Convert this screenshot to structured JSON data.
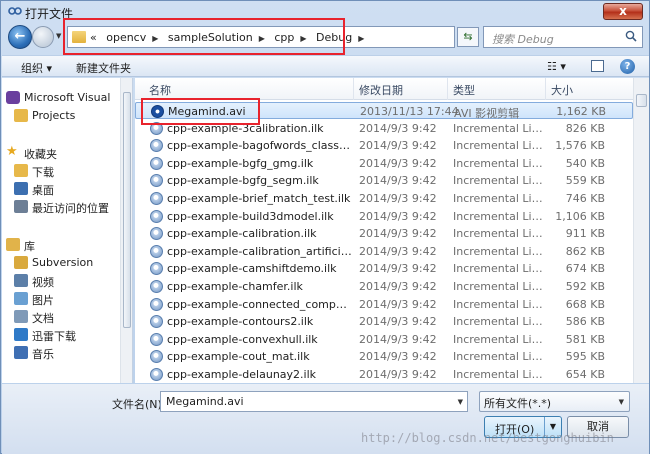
{
  "window": {
    "title": "打开文件",
    "close_label": "x"
  },
  "nav": {
    "back_glyph": "←"
  },
  "address": {
    "crumbs": [
      "«",
      "opencv",
      "sampleSolution",
      "cpp",
      "Debug"
    ]
  },
  "search": {
    "placeholder": "搜索 Debug"
  },
  "toolbar": {
    "organize": "组织 ▾",
    "new_folder": "新建文件夹"
  },
  "sidebar": {
    "items": [
      {
        "label": "Microsoft Visual",
        "icon": "visual-studio-icon",
        "group": "top"
      },
      {
        "label": "Projects",
        "icon": "folder-icon",
        "group": "child"
      },
      {
        "label": "收藏夹",
        "icon": "star-icon",
        "group": "top"
      },
      {
        "label": "下载",
        "icon": "download-folder-icon",
        "group": "child"
      },
      {
        "label": "桌面",
        "icon": "desktop-icon",
        "group": "child"
      },
      {
        "label": "最近访问的位置",
        "icon": "recent-places-icon",
        "group": "child"
      },
      {
        "label": "库",
        "icon": "library-icon",
        "group": "top"
      },
      {
        "label": "Subversion",
        "icon": "library-folder-icon",
        "group": "child"
      },
      {
        "label": "视频",
        "icon": "video-library-icon",
        "group": "child"
      },
      {
        "label": "图片",
        "icon": "pictures-library-icon",
        "group": "child"
      },
      {
        "label": "文档",
        "icon": "documents-library-icon",
        "group": "child"
      },
      {
        "label": "迅雷下载",
        "icon": "thunder-download-icon",
        "group": "child"
      },
      {
        "label": "音乐",
        "icon": "music-library-icon",
        "group": "child"
      }
    ]
  },
  "columns": {
    "name": "名称",
    "date": "修改日期",
    "type": "类型",
    "size": "大小"
  },
  "files": [
    {
      "name": "Megamind.avi",
      "date": "2013/11/13 17:44",
      "type": "AVI 影视剪辑",
      "size": "1,162 KB",
      "selected": true,
      "icon": "avi"
    },
    {
      "name": "cpp-example-3calibration.ilk",
      "date": "2014/9/3 9:42",
      "type": "Incremental Link...",
      "size": "826 KB"
    },
    {
      "name": "cpp-example-bagofwords_classificati...",
      "date": "2014/9/3 9:42",
      "type": "Incremental Link...",
      "size": "1,576 KB"
    },
    {
      "name": "cpp-example-bgfg_gmg.ilk",
      "date": "2014/9/3 9:42",
      "type": "Incremental Link...",
      "size": "540 KB"
    },
    {
      "name": "cpp-example-bgfg_segm.ilk",
      "date": "2014/9/3 9:42",
      "type": "Incremental Link...",
      "size": "559 KB"
    },
    {
      "name": "cpp-example-brief_match_test.ilk",
      "date": "2014/9/3 9:42",
      "type": "Incremental Link...",
      "size": "746 KB"
    },
    {
      "name": "cpp-example-build3dmodel.ilk",
      "date": "2014/9/3 9:42",
      "type": "Incremental Link...",
      "size": "1,106 KB"
    },
    {
      "name": "cpp-example-calibration.ilk",
      "date": "2014/9/3 9:42",
      "type": "Incremental Link...",
      "size": "911 KB"
    },
    {
      "name": "cpp-example-calibration_artificial.ilk",
      "date": "2014/9/3 9:42",
      "type": "Incremental Link...",
      "size": "862 KB"
    },
    {
      "name": "cpp-example-camshiftdemo.ilk",
      "date": "2014/9/3 9:42",
      "type": "Incremental Link...",
      "size": "674 KB"
    },
    {
      "name": "cpp-example-chamfer.ilk",
      "date": "2014/9/3 9:42",
      "type": "Incremental Link...",
      "size": "592 KB"
    },
    {
      "name": "cpp-example-connected_component...",
      "date": "2014/9/3 9:42",
      "type": "Incremental Link...",
      "size": "668 KB"
    },
    {
      "name": "cpp-example-contours2.ilk",
      "date": "2014/9/3 9:42",
      "type": "Incremental Link...",
      "size": "586 KB"
    },
    {
      "name": "cpp-example-convexhull.ilk",
      "date": "2014/9/3 9:42",
      "type": "Incremental Link...",
      "size": "581 KB"
    },
    {
      "name": "cpp-example-cout_mat.ilk",
      "date": "2014/9/3 9:42",
      "type": "Incremental Link...",
      "size": "595 KB"
    },
    {
      "name": "cpp-example-delaunay2.ilk",
      "date": "2014/9/3 9:42",
      "type": "Incremental Link...",
      "size": "654 KB"
    }
  ],
  "footer": {
    "filename_label": "文件名(N):",
    "filename_value": "Megamind.avi",
    "filetype_value": "所有文件(*.*)",
    "open_label": "打开(O)",
    "cancel_label": "取消"
  },
  "watermark": "http://blog.csdn.net/bestgonghuibin",
  "colors": {
    "highlight": "#e8232d",
    "selection": "#cfe4fb",
    "accent": "#3c7fb1"
  }
}
